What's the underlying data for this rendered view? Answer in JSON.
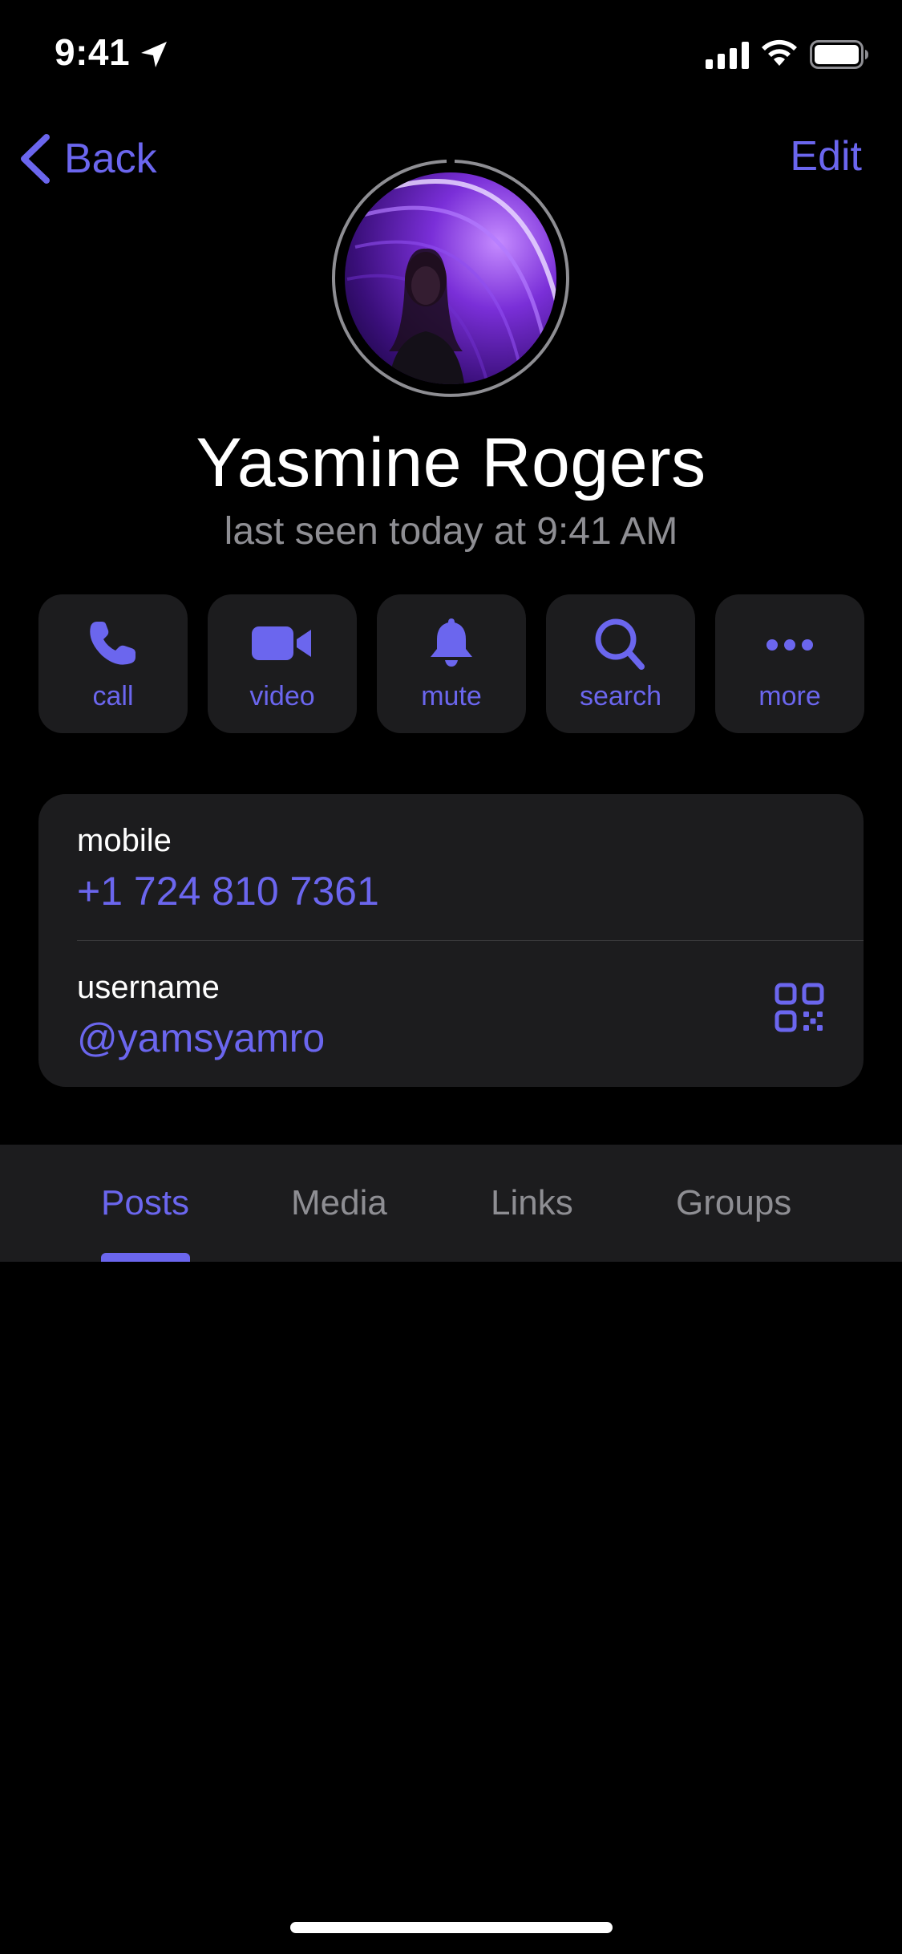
{
  "status_bar": {
    "time": "9:41"
  },
  "nav": {
    "back_label": "Back",
    "edit_label": "Edit"
  },
  "profile": {
    "name": "Yasmine Rogers",
    "status": "last seen today at 9:41 AM"
  },
  "actions": [
    {
      "label": "call",
      "icon": "phone-icon"
    },
    {
      "label": "video",
      "icon": "video-camera-icon"
    },
    {
      "label": "mute",
      "icon": "bell-icon"
    },
    {
      "label": "search",
      "icon": "search-icon"
    },
    {
      "label": "more",
      "icon": "ellipsis-icon"
    }
  ],
  "info": {
    "mobile_label": "mobile",
    "mobile_value": "+1 724 810 7361",
    "username_label": "username",
    "username_value": "@yamsyamro"
  },
  "tabs": [
    {
      "label": "Posts",
      "active": true
    },
    {
      "label": "Media",
      "active": false
    },
    {
      "label": "Links",
      "active": false
    },
    {
      "label": "Groups",
      "active": false
    }
  ],
  "colors": {
    "accent": "#6b66ee",
    "background": "#000000",
    "card": "#1c1c1e",
    "secondary_text": "#8e8e93"
  }
}
